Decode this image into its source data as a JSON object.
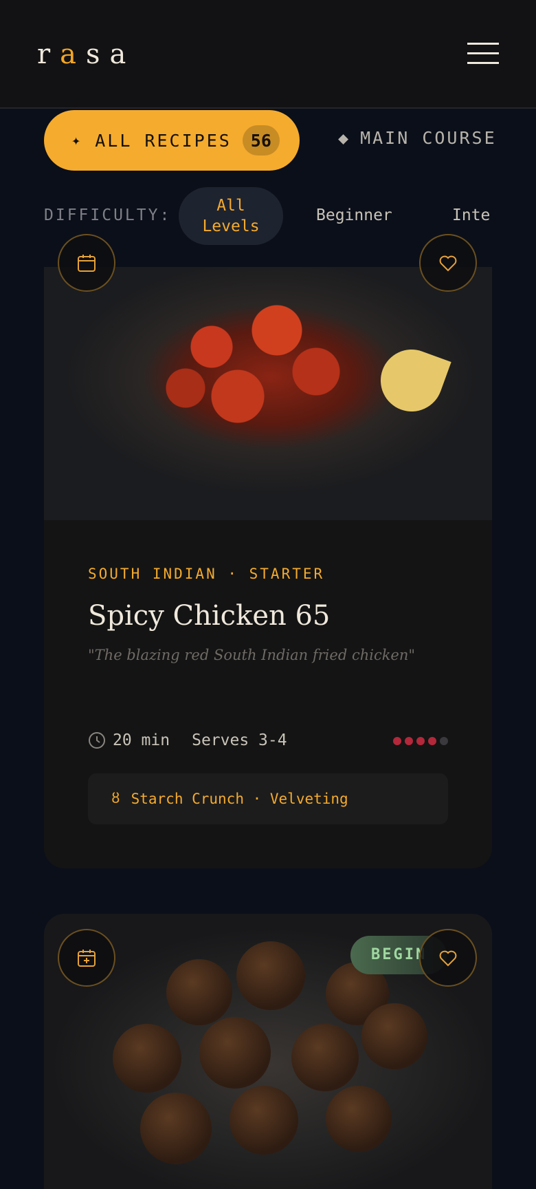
{
  "header": {
    "logo_letters": [
      "r",
      "a",
      "s",
      "a"
    ]
  },
  "filters": {
    "primary_label": "ALL RECIPES",
    "primary_count": "56",
    "primary_icon": "sparkle-icon",
    "secondary_label": "MAIN COURSE",
    "secondary_icon": "diamond-icon"
  },
  "difficulty": {
    "label": "DIFFICULTY:",
    "options": [
      {
        "label_line1": "All",
        "label_line2": "Levels",
        "selected": true
      },
      {
        "label": "Beginner",
        "selected": false
      },
      {
        "label": "Inte",
        "selected": false
      }
    ]
  },
  "recipes": [
    {
      "cuisine": "SOUTH INDIAN · STARTER",
      "title": "Spicy Chicken 65",
      "tagline": "\"The blazing red South Indian fried chicken\"",
      "time": "20 min",
      "serves": "Serves 3-4",
      "spice_level": 4,
      "spice_max": 5,
      "technique": "Starch Crunch · Velveting",
      "technique_icon": "hourglass-icon"
    },
    {
      "level_badge": "BEGIN"
    }
  ],
  "colors": {
    "accent": "#f5ab2e",
    "background": "#0b0f19",
    "card": "#141414",
    "spice_dot": "#b3283a",
    "beginner_badge": "#9fd8a0"
  }
}
